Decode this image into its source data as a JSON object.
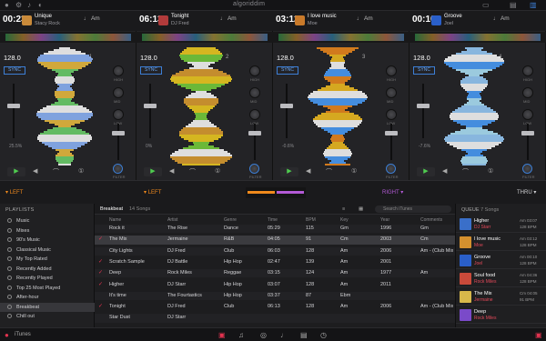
{
  "brand": "algoriddim",
  "decks": [
    {
      "time": "00:23",
      "title": "Unique",
      "artist": "Stacy Rock",
      "key": "Am",
      "bpm": "128.0",
      "sync": "SYNC",
      "deck_no": "1",
      "pitch": "25.5%",
      "art_color": "#c98a3a"
    },
    {
      "time": "06:13",
      "title": "Tonight",
      "artist": "DJ Fred",
      "key": "Am",
      "bpm": "128.0",
      "sync": "SYNC",
      "deck_no": "2",
      "pitch": "0%",
      "art_color": "#b23b3b"
    },
    {
      "time": "03:12",
      "title": "I love music",
      "artist": "Moe",
      "key": "Am",
      "bpm": "128.0",
      "sync": "SYNC",
      "deck_no": "3",
      "pitch": "-0.6%",
      "art_color": "#c97a2a"
    },
    {
      "time": "00:10",
      "title": "Groove",
      "artist": "Joel",
      "key": "Am",
      "bpm": "128.0",
      "sync": "SYNC",
      "deck_no": "4",
      "pitch": "-7.6%",
      "art_color": "#2a5fc9"
    }
  ],
  "eq": {
    "high": "HIGH",
    "mid": "MID",
    "low": "LOW",
    "filter": "FILTER"
  },
  "crossfader": {
    "left1": "LEFT",
    "left2": "LEFT",
    "right": "RIGHT",
    "thru": "THRU"
  },
  "sidebar": {
    "header": "PLAYLISTS",
    "items": [
      "Music",
      "Mixes",
      "90's Music",
      "Classical Music",
      "My Top Rated",
      "Recently Added",
      "Recently Played",
      "Top 25 Most Played",
      "After-hour",
      "Breakbeat",
      "Chill out"
    ],
    "selected_index": 9
  },
  "library": {
    "playlist": "Breakbeat",
    "count": "14 Songs",
    "search_placeholder": "Search iTunes",
    "columns": [
      "Name",
      "Artist",
      "Genre",
      "Time",
      "BPM",
      "Key",
      "Year",
      "Comments"
    ],
    "rows": [
      [
        "Rock it",
        "The Rise",
        "Dance",
        "05:29",
        "115",
        "Gm",
        "1996",
        "Gm"
      ],
      [
        "The Mix",
        "Jermaine",
        "R&B",
        "04:05",
        "91",
        "Cm",
        "2003",
        "Cm"
      ],
      [
        "City Lights",
        "DJ Fred",
        "Club",
        "06:03",
        "128",
        "Am",
        "2006",
        "Am - (Club Mix)"
      ],
      [
        "Scratch Sample",
        "DJ Battle",
        "Hip Hop",
        "02:47",
        "139",
        "Am",
        "2001",
        ""
      ],
      [
        "Deep",
        "Rock Miles",
        "Reggae",
        "03:15",
        "124",
        "Am",
        "1977",
        "Am"
      ],
      [
        "Higher",
        "DJ Starr",
        "Hip Hop",
        "03:07",
        "128",
        "Am",
        "2011",
        ""
      ],
      [
        "It's time",
        "The Fourtastics",
        "Hip Hop",
        "03:37",
        "87",
        "Ebm",
        "",
        ""
      ],
      [
        "Tonight",
        "DJ Fred",
        "Club",
        "06:13",
        "128",
        "Am",
        "2006",
        "Am - (Club Mix)"
      ],
      [
        "Star Dust",
        "DJ Starr",
        "",
        "",
        "",
        "",
        "",
        ""
      ]
    ],
    "selected_row": 1,
    "checked_rows": [
      1,
      3,
      4,
      5,
      7
    ]
  },
  "queue": {
    "header": "QUEUE",
    "count": "7 Songs",
    "items": [
      {
        "title": "Higher",
        "artist": "DJ Starr",
        "key": "Am 03:07",
        "bpm": "128 BPM",
        "color": "#3a6fc9"
      },
      {
        "title": "I love music",
        "artist": "Moe",
        "key": "Am 03:12",
        "bpm": "128 BPM",
        "color": "#d4902e"
      },
      {
        "title": "Groove",
        "artist": "Joel",
        "key": "Am 00:10",
        "bpm": "128 BPM",
        "color": "#2a5fc9"
      },
      {
        "title": "Soul food",
        "artist": "Rock Miles",
        "key": "Am 04:36",
        "bpm": "128 BPM",
        "color": "#c94a3a"
      },
      {
        "title": "The Mix",
        "artist": "Jermaine",
        "key": "Cm 04:05",
        "bpm": "91 BPM",
        "color": "#d8b84a"
      },
      {
        "title": "Deep",
        "artist": "Rock Miles",
        "key": "",
        "bpm": "",
        "color": "#7a4ac9"
      }
    ]
  },
  "bottom": {
    "source": "iTunes"
  },
  "colors": {
    "accent": "#e2334f",
    "orange": "#f08a1c",
    "purple": "#b35ad6",
    "sync_blue": "#3d7fd6",
    "play_green": "#4fcc4f"
  }
}
